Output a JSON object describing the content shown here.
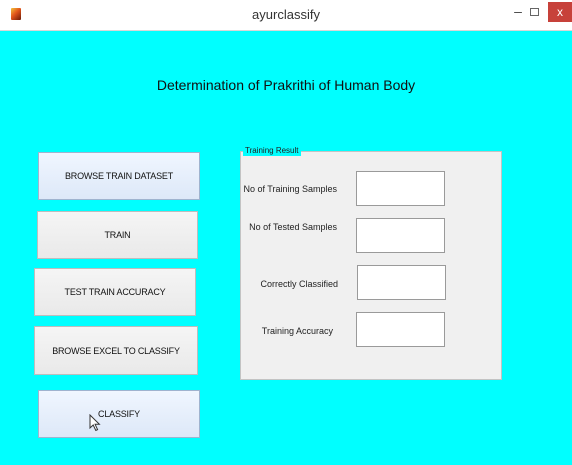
{
  "window": {
    "title": "ayurclassify",
    "minimize_glyph": "–",
    "close_glyph": "x"
  },
  "app": {
    "heading": "Determination of Prakrithi of Human Body"
  },
  "buttons": {
    "browse_train": "BROWSE TRAIN DATASET",
    "train": "TRAIN",
    "test_accuracy": "TEST TRAIN ACCURACY",
    "browse_excel": "BROWSE EXCEL TO CLASSIFY",
    "classify": "CLASSIFY"
  },
  "training_result": {
    "title": "Training Result",
    "fields": [
      {
        "label": "No of Training Samples",
        "value": ""
      },
      {
        "label": "No of Tested Samples",
        "value": ""
      },
      {
        "label": "Correctly Classified",
        "value": ""
      },
      {
        "label": "Training Accuracy",
        "value": ""
      }
    ]
  },
  "colors": {
    "background": "#00ffff",
    "close_button": "#c7413a"
  },
  "icons": {
    "app": "matlab-icon",
    "cursor": "mouse-pointer-icon"
  }
}
